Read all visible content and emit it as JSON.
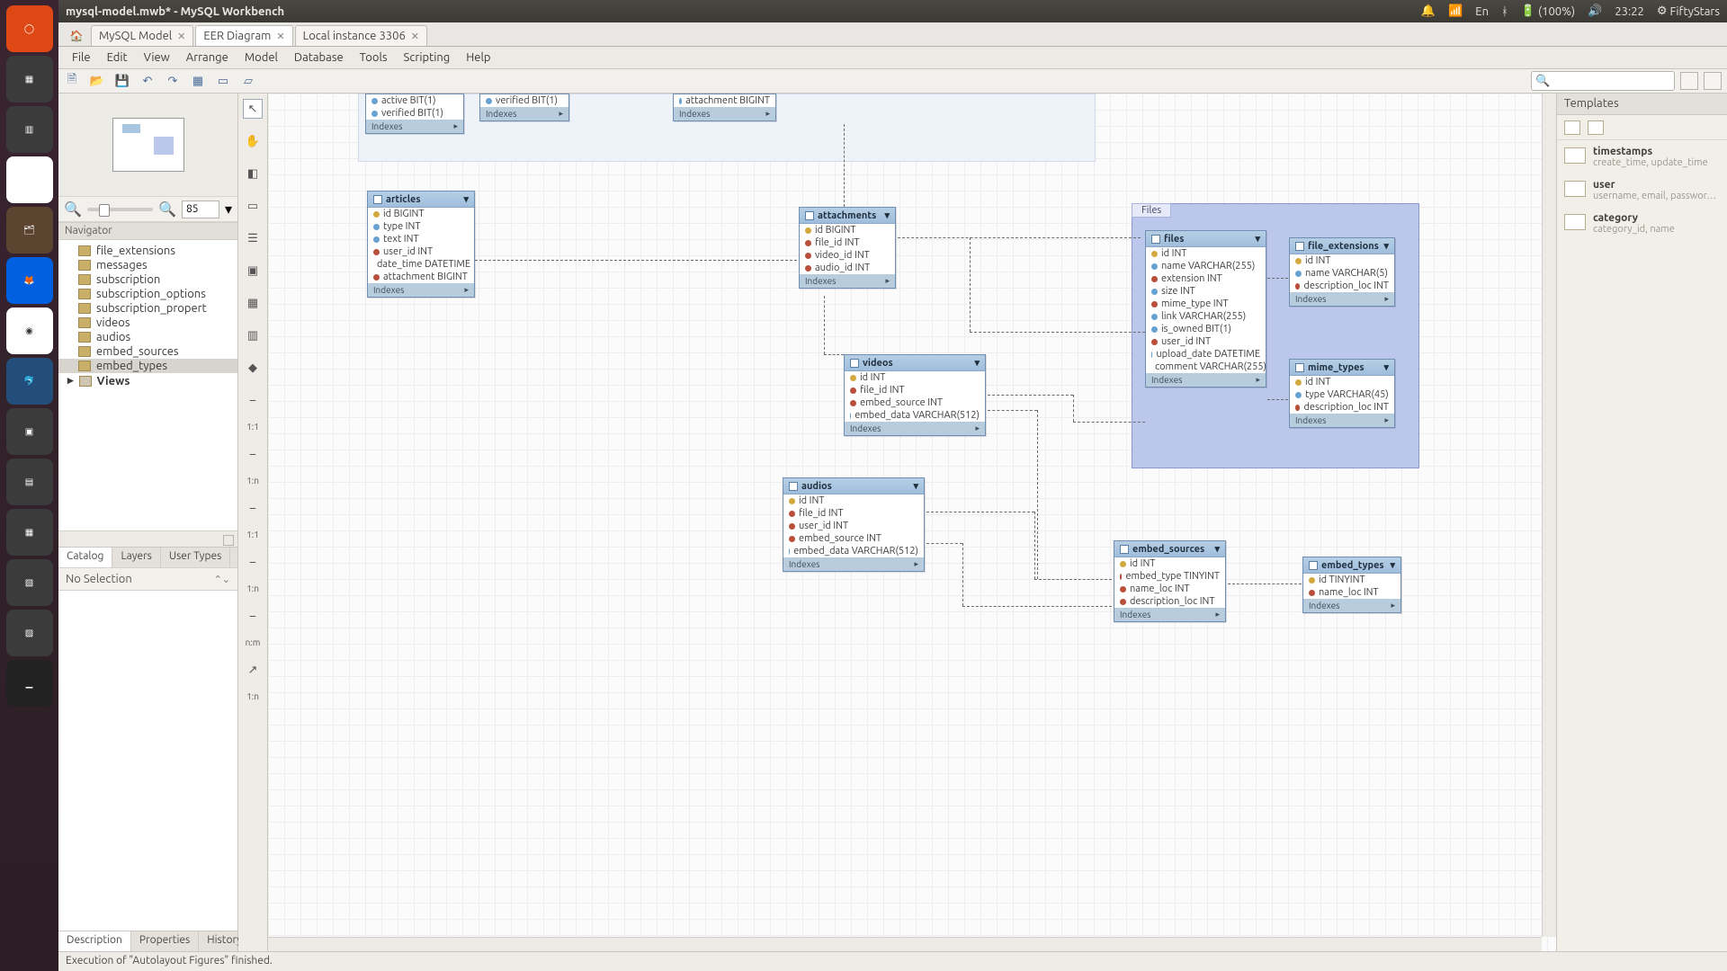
{
  "window": {
    "title": "mysql-model.mwb* - MySQL Workbench"
  },
  "system_tray": {
    "lang": "En",
    "battery": "(100%)",
    "time": "23:22",
    "user": "FiftyStars"
  },
  "doc_tabs": [
    {
      "label": "MySQL Model",
      "active": false
    },
    {
      "label": "EER Diagram",
      "active": true
    },
    {
      "label": "Local instance 3306",
      "active": false
    }
  ],
  "menu": [
    "File",
    "Edit",
    "View",
    "Arrange",
    "Model",
    "Database",
    "Tools",
    "Scripting",
    "Help"
  ],
  "zoom": {
    "value": "85"
  },
  "navigator": {
    "label": "Navigator",
    "tree": [
      "file_extensions",
      "messages",
      "subscription",
      "subscription_options",
      "subscription_propert",
      "videos",
      "audios",
      "embed_sources",
      "embed_types"
    ],
    "views_label": "Views",
    "selected": "embed_types",
    "tabs": [
      "Catalog",
      "Layers",
      "User Types"
    ],
    "active_tab": "Catalog",
    "selection": "No Selection",
    "bottom_tabs": [
      "Description",
      "Properties",
      "History"
    ],
    "active_bottom": "Description"
  },
  "tool_labels": [
    "1:1",
    "1:n",
    "1:1",
    "1:n",
    "n:m",
    "1:n"
  ],
  "group": {
    "files_title": "Files"
  },
  "tables": {
    "top1": {
      "rows": [
        "active BIT(1)",
        "verified BIT(1)"
      ],
      "idx": "Indexes"
    },
    "top2": {
      "rows": [
        "verified BIT(1)"
      ],
      "idx": "Indexes"
    },
    "top3": {
      "rows": [
        "attachment BIGINT"
      ],
      "idx": "Indexes"
    },
    "articles": {
      "name": "articles",
      "rows": [
        "id BIGINT",
        "type INT",
        "text INT",
        "user_id INT",
        "date_time DATETIME",
        "attachment BIGINT"
      ],
      "idx": "Indexes"
    },
    "attachments": {
      "name": "attachments",
      "rows": [
        "id BIGINT",
        "file_id INT",
        "video_id INT",
        "audio_id INT"
      ],
      "idx": "Indexes"
    },
    "videos": {
      "name": "videos",
      "rows": [
        "id INT",
        "file_id INT",
        "embed_source INT",
        "embed_data VARCHAR(512)"
      ],
      "idx": "Indexes"
    },
    "audios": {
      "name": "audios",
      "rows": [
        "id INT",
        "file_id INT",
        "user_id INT",
        "embed_source INT",
        "embed_data VARCHAR(512)"
      ],
      "idx": "Indexes"
    },
    "files": {
      "name": "files",
      "rows": [
        "id INT",
        "name VARCHAR(255)",
        "extension INT",
        "size INT",
        "mime_type INT",
        "link VARCHAR(255)",
        "is_owned BIT(1)",
        "user_id INT",
        "upload_date DATETIME",
        "comment VARCHAR(255)"
      ],
      "idx": "Indexes"
    },
    "file_ext": {
      "name": "file_extensions",
      "rows": [
        "id INT",
        "name VARCHAR(5)",
        "description_loc INT"
      ],
      "idx": "Indexes"
    },
    "mime": {
      "name": "mime_types",
      "rows": [
        "id INT",
        "type VARCHAR(45)",
        "description_loc INT"
      ],
      "idx": "Indexes"
    },
    "embed_src": {
      "name": "embed_sources",
      "rows": [
        "id INT",
        "embed_type TINYINT",
        "name_loc INT",
        "description_loc INT"
      ],
      "idx": "Indexes"
    },
    "embed_types": {
      "name": "embed_types",
      "rows": [
        "id TINYINT",
        "name_loc INT"
      ],
      "idx": "Indexes"
    }
  },
  "templates": {
    "title": "Templates",
    "items": [
      {
        "name": "timestamps",
        "desc": "create_time, update_time"
      },
      {
        "name": "user",
        "desc": "username, email, passwor…"
      },
      {
        "name": "category",
        "desc": "category_id, name"
      }
    ]
  },
  "status": "Execution of \"Autolayout Figures\" finished."
}
